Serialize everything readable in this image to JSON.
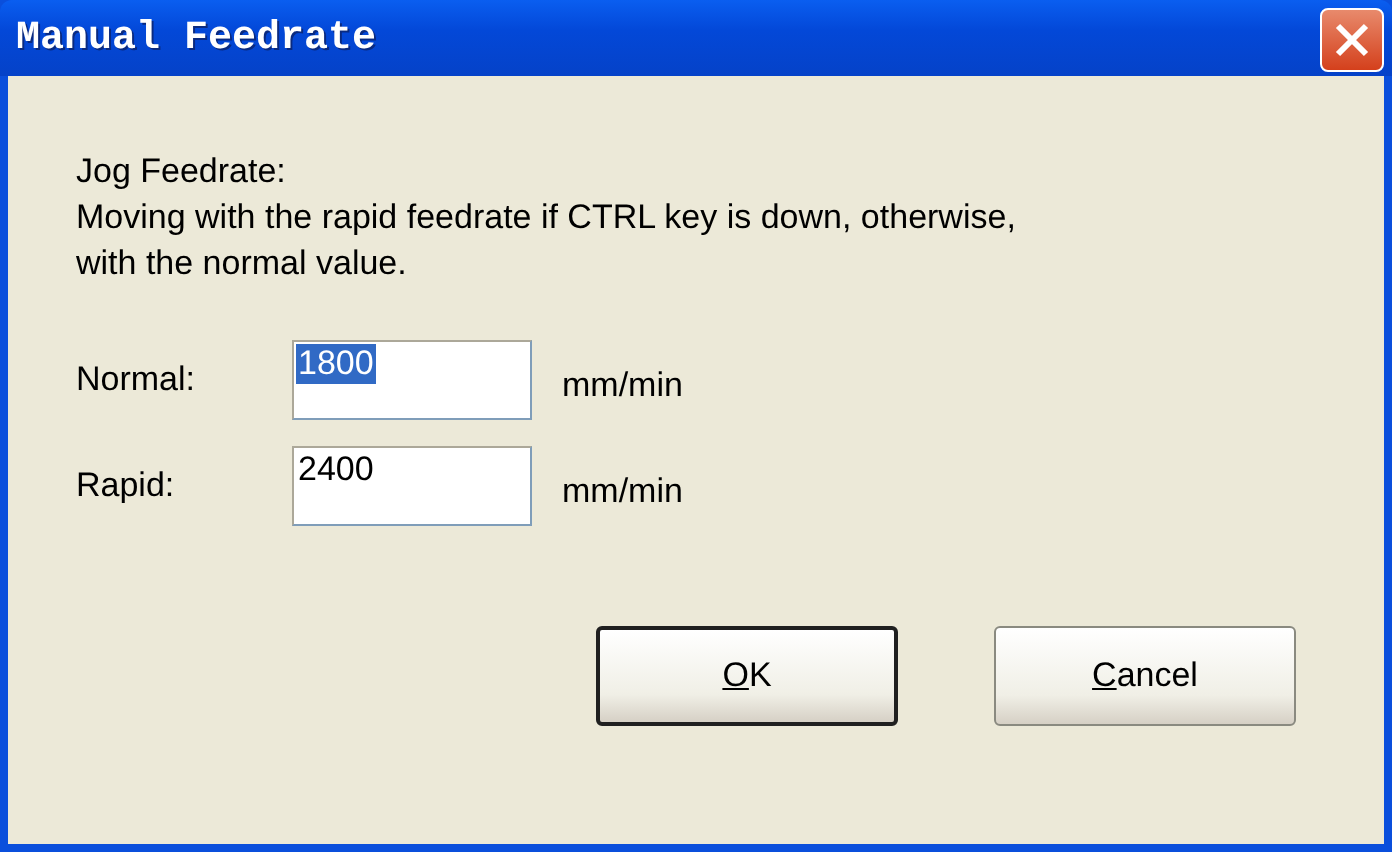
{
  "window": {
    "title": "Manual Feedrate"
  },
  "description": [
    "Jog Feedrate:",
    "Moving with the rapid feedrate if CTRL key is down, otherwise,",
    "with the normal value."
  ],
  "fields": [
    {
      "label": "Normal:",
      "value": "1800",
      "selected": true,
      "unit": "mm/min"
    },
    {
      "label": "Rapid:",
      "value": "2400",
      "selected": false,
      "unit": "mm/min"
    }
  ],
  "buttons": [
    {
      "label": "OK",
      "default": true
    },
    {
      "label": "Cancel",
      "default": false
    }
  ]
}
